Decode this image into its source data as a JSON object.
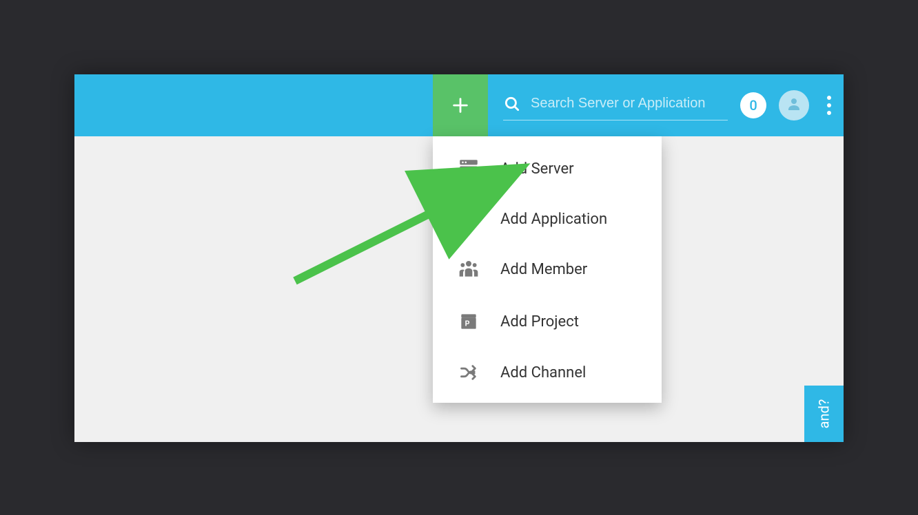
{
  "header": {
    "search_placeholder": "Search Server or Application",
    "notification_count": "0"
  },
  "add_menu": {
    "items": [
      {
        "label": "Add Server"
      },
      {
        "label": "Add Application"
      },
      {
        "label": "Add Member"
      },
      {
        "label": "Add Project"
      },
      {
        "label": "Add Channel"
      }
    ]
  },
  "help_tab": {
    "visible_text": "and?"
  }
}
